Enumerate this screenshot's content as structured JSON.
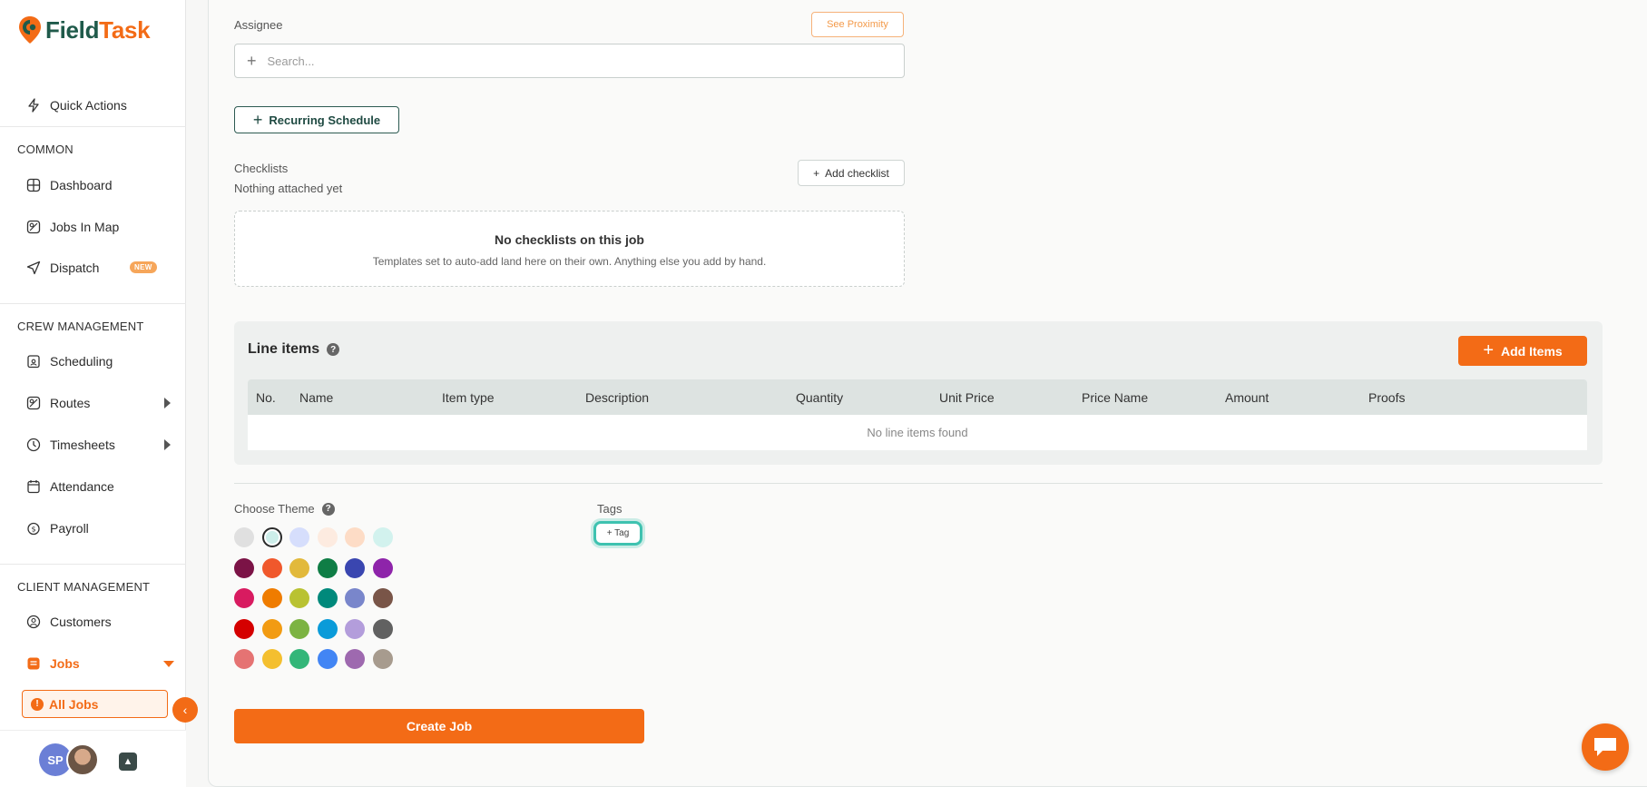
{
  "app": {
    "logo_part1": "Field",
    "logo_part2": "Task"
  },
  "sidebar": {
    "quick_actions": "Quick Actions",
    "sections": {
      "common": "COMMON",
      "crew": "CREW MANAGEMENT",
      "client": "CLIENT MANAGEMENT"
    },
    "items": {
      "dashboard": "Dashboard",
      "jobs_in_map": "Jobs In Map",
      "dispatch": "Dispatch",
      "dispatch_badge": "NEW",
      "scheduling": "Scheduling",
      "routes": "Routes",
      "timesheets": "Timesheets",
      "attendance": "Attendance",
      "payroll": "Payroll",
      "customers": "Customers",
      "jobs": "Jobs",
      "all_jobs": "All Jobs"
    },
    "footer": {
      "avatar_initials": "SP"
    }
  },
  "form": {
    "assignee_label": "Assignee",
    "see_proximity": "See Proximity",
    "search_placeholder": "Search...",
    "recurring_schedule": "Recurring Schedule",
    "checklists_label": "Checklists",
    "checklists_sub": "Nothing attached yet",
    "add_checklist": "Add checklist",
    "empty_title": "No checklists on this job",
    "empty_desc": "Templates set to auto-add land here on their own. Anything else you add by hand.",
    "line_items_title": "Line items",
    "add_items": "Add Items",
    "table_columns": [
      "No.",
      "Name",
      "Item type",
      "Description",
      "Quantity",
      "Unit Price",
      "Price Name",
      "Amount",
      "Proofs"
    ],
    "table_empty": "No line items found",
    "choose_theme": "Choose Theme",
    "tags_label": "Tags",
    "add_tag": "+ Tag",
    "create_job": "Create Job"
  },
  "theme_colors": [
    [
      "#e0e0e0",
      "#cdeeea",
      "#d6defc",
      "#fdebe0",
      "#fddcc6",
      "#d2f2ee"
    ],
    [
      "#7b1346",
      "#f0582c",
      "#e2b93b",
      "#0f7d45",
      "#3a46b0",
      "#8e24aa"
    ],
    [
      "#d81b60",
      "#ef7c00",
      "#b9c232",
      "#00897b",
      "#7986cb",
      "#795548"
    ],
    [
      "#d50000",
      "#f29b12",
      "#7cb342",
      "#0a9bd9",
      "#b39ddb",
      "#616161"
    ],
    [
      "#e57373",
      "#f4bf2f",
      "#33b679",
      "#4285f4",
      "#9e69af",
      "#a79b8e"
    ]
  ],
  "selected_theme": [
    0,
    1
  ],
  "colors": {
    "accent": "#f36b16",
    "brand_green": "#1f5a4a",
    "tag_outline": "#3fc2b0"
  }
}
